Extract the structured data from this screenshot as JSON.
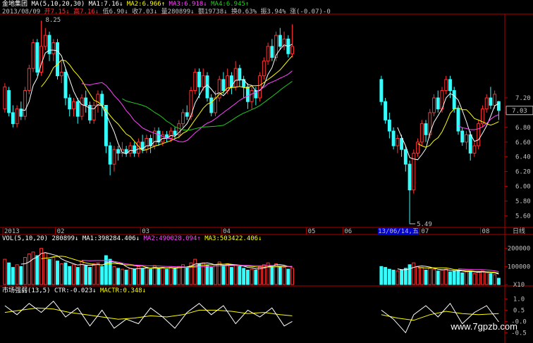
{
  "header": {
    "stock_name": "金地集团",
    "ma_label": "MA(5,10,20,30)",
    "ma1": "MA1:7.16↓",
    "ma2": "MA2:6.966↑",
    "ma3": "MA3:6.918↓",
    "ma4": "MA4:6.945↑",
    "date": "2013/08/09",
    "open": "开7.15↓",
    "high": "高7.16↓",
    "low": "低6.90↓",
    "close": "收7.03↓",
    "volume": "量280899↓",
    "amount": "额19738↓",
    "turnover": "换0.63%",
    "amplitude": "振3.94%",
    "change": "涨(-0.07)-0"
  },
  "price_panel": {
    "high_mark": "8.25",
    "low_mark": "5.49",
    "current_price": "7.03",
    "y_ticks": [
      "7.20",
      "7.00",
      "6.80",
      "6.60",
      "6.40",
      "6.20",
      "6.00",
      "5.80",
      "5.60"
    ],
    "x_ticks": [
      "2013",
      "02",
      "03",
      "04",
      "05",
      "06",
      "07",
      "08"
    ],
    "cursor_date": "13/06/14,五",
    "period": "日线"
  },
  "volume_panel": {
    "label": "VOL(5,10,20)",
    "value": "280899↓",
    "ma1": "MA1:398284.406↓",
    "ma2": "MA2:490028.094↑",
    "ma3": "MA3:503422.406↓",
    "y_ticks": [
      "200000",
      "100000",
      "X10"
    ]
  },
  "indicator_panel": {
    "name": "市场强弱(13,5)",
    "ctr": "CTR:-0.023↓",
    "mactr": "MACTR:0.348↓",
    "y_ticks": [
      "1.0",
      "0.5",
      "-0.0",
      "-0.5"
    ]
  },
  "watermark": "www.7gpzb.com",
  "colors": {
    "up": "#ff3333",
    "down": "#33ffff",
    "ma1": "#ffffff",
    "ma2": "#ffff00",
    "ma3": "#ff44ff",
    "ma4": "#22cc22",
    "axis": "#b00000"
  },
  "chart_data": {
    "type": "candlestick",
    "y_range": [
      5.45,
      8.3
    ],
    "gap_range": [
      85,
      92
    ],
    "candles": [
      [
        0,
        7.05,
        7.35,
        7.4,
        7.0
      ],
      [
        1,
        7.3,
        7.0,
        7.35,
        6.95
      ],
      [
        2,
        7.0,
        6.85,
        7.1,
        6.8
      ],
      [
        3,
        6.85,
        7.05,
        7.1,
        6.8
      ],
      [
        4,
        7.05,
        6.95,
        7.15,
        6.9
      ],
      [
        5,
        6.95,
        7.3,
        7.35,
        6.9
      ],
      [
        6,
        7.3,
        7.6,
        7.65,
        7.25
      ],
      [
        7,
        7.6,
        7.95,
        8.0,
        7.55
      ],
      [
        8,
        7.95,
        7.55,
        8.0,
        7.5
      ],
      [
        9,
        7.55,
        7.9,
        8.25,
        7.5
      ],
      [
        10,
        7.9,
        8.05,
        8.15,
        7.85
      ],
      [
        11,
        8.05,
        7.8,
        8.1,
        7.7
      ],
      [
        12,
        7.8,
        7.95,
        8.0,
        7.7
      ],
      [
        13,
        7.95,
        7.5,
        8.0,
        7.45
      ],
      [
        14,
        7.5,
        7.55,
        7.7,
        7.4
      ],
      [
        15,
        7.55,
        7.2,
        7.6,
        7.1
      ],
      [
        16,
        7.2,
        7.05,
        7.25,
        6.95
      ],
      [
        17,
        7.05,
        7.15,
        7.2,
        6.95
      ],
      [
        18,
        7.15,
        6.95,
        7.2,
        6.85
      ],
      [
        19,
        6.95,
        7.2,
        7.25,
        6.9
      ],
      [
        20,
        7.2,
        7.1,
        7.3,
        7.0
      ],
      [
        21,
        7.1,
        6.9,
        7.15,
        6.85
      ],
      [
        22,
        6.9,
        7.1,
        7.15,
        6.85
      ],
      [
        23,
        7.1,
        7.25,
        7.3,
        7.0
      ],
      [
        24,
        7.25,
        7.1,
        7.3,
        6.95
      ],
      [
        25,
        7.1,
        6.55,
        7.1,
        6.45
      ],
      [
        26,
        6.55,
        6.3,
        6.6,
        6.15
      ],
      [
        27,
        6.3,
        6.5,
        6.55,
        6.2
      ],
      [
        28,
        6.5,
        6.45,
        6.55,
        6.35
      ],
      [
        29,
        6.45,
        6.5,
        6.6,
        6.4
      ],
      [
        30,
        6.5,
        6.45,
        6.55,
        6.4
      ],
      [
        31,
        6.45,
        6.55,
        6.6,
        6.4
      ],
      [
        32,
        6.55,
        6.45,
        6.6,
        6.4
      ],
      [
        33,
        6.45,
        6.6,
        6.65,
        6.4
      ],
      [
        34,
        6.6,
        6.5,
        6.7,
        6.45
      ],
      [
        35,
        6.5,
        6.65,
        6.7,
        6.45
      ],
      [
        36,
        6.65,
        6.55,
        6.7,
        6.45
      ],
      [
        37,
        6.55,
        6.75,
        6.8,
        6.5
      ],
      [
        38,
        6.75,
        6.6,
        6.8,
        6.55
      ],
      [
        39,
        6.6,
        6.7,
        6.75,
        6.55
      ],
      [
        40,
        6.7,
        6.65,
        6.75,
        6.6
      ],
      [
        41,
        6.65,
        6.75,
        6.8,
        6.6
      ],
      [
        42,
        6.75,
        6.7,
        6.8,
        6.65
      ],
      [
        43,
        6.7,
        6.85,
        6.9,
        6.65
      ],
      [
        44,
        6.85,
        7.0,
        7.05,
        6.8
      ],
      [
        45,
        7.0,
        6.95,
        7.1,
        6.9
      ],
      [
        46,
        6.95,
        7.3,
        7.35,
        6.9
      ],
      [
        47,
        7.3,
        7.55,
        7.6,
        7.25
      ],
      [
        48,
        7.55,
        7.35,
        7.6,
        7.2
      ],
      [
        49,
        7.35,
        7.5,
        7.6,
        7.3
      ],
      [
        50,
        7.5,
        7.2,
        7.55,
        7.15
      ],
      [
        51,
        7.2,
        7.0,
        7.25,
        6.95
      ],
      [
        52,
        7.0,
        7.2,
        7.3,
        6.95
      ],
      [
        53,
        7.2,
        7.45,
        7.5,
        7.15
      ],
      [
        54,
        7.45,
        7.3,
        7.55,
        7.25
      ],
      [
        55,
        7.3,
        7.5,
        7.6,
        7.25
      ],
      [
        56,
        7.5,
        7.35,
        7.55,
        7.25
      ],
      [
        57,
        7.35,
        7.6,
        7.7,
        7.3
      ],
      [
        58,
        7.6,
        7.45,
        7.65,
        7.35
      ],
      [
        59,
        7.45,
        7.35,
        7.5,
        7.2
      ],
      [
        60,
        7.35,
        7.15,
        7.4,
        7.05
      ],
      [
        61,
        7.15,
        7.3,
        7.35,
        7.05
      ],
      [
        62,
        7.3,
        7.2,
        7.35,
        7.1
      ],
      [
        63,
        7.2,
        7.5,
        7.55,
        7.15
      ],
      [
        64,
        7.5,
        7.7,
        7.75,
        7.45
      ],
      [
        65,
        7.7,
        7.9,
        7.95,
        7.65
      ],
      [
        66,
        7.9,
        7.75,
        8.0,
        7.7
      ],
      [
        67,
        7.75,
        8.05,
        8.1,
        7.7
      ],
      [
        68,
        8.05,
        7.9,
        8.15,
        7.85
      ],
      [
        69,
        7.9,
        8.0,
        8.1,
        7.85
      ],
      [
        70,
        8.0,
        7.8,
        8.05,
        7.75
      ],
      [
        71,
        7.8,
        7.9,
        8.2,
        7.75
      ],
      [
        93,
        7.45,
        7.15,
        7.5,
        7.1
      ],
      [
        94,
        7.15,
        6.9,
        7.2,
        6.85
      ],
      [
        95,
        6.9,
        6.75,
        7.0,
        6.65
      ],
      [
        96,
        6.75,
        6.55,
        6.8,
        6.5
      ],
      [
        97,
        6.55,
        6.65,
        6.7,
        6.45
      ],
      [
        98,
        6.65,
        6.5,
        6.7,
        6.4
      ],
      [
        99,
        6.5,
        6.3,
        6.55,
        6.2
      ],
      [
        100,
        6.3,
        5.95,
        6.35,
        5.49
      ],
      [
        101,
        5.95,
        6.45,
        6.5,
        5.9
      ],
      [
        102,
        6.45,
        6.6,
        6.65,
        6.4
      ],
      [
        103,
        6.6,
        6.85,
        6.9,
        6.55
      ],
      [
        104,
        6.85,
        6.7,
        6.9,
        6.6
      ],
      [
        105,
        6.7,
        7.0,
        7.05,
        6.65
      ],
      [
        106,
        7.0,
        7.2,
        7.25,
        6.95
      ],
      [
        107,
        7.2,
        7.05,
        7.3,
        7.0
      ],
      [
        108,
        7.05,
        7.3,
        7.35,
        7.0
      ],
      [
        109,
        7.3,
        7.45,
        7.5,
        7.25
      ],
      [
        110,
        7.45,
        7.3,
        7.5,
        7.2
      ],
      [
        111,
        7.3,
        7.05,
        7.35,
        7.0
      ],
      [
        112,
        7.05,
        6.75,
        7.1,
        6.7
      ],
      [
        113,
        6.75,
        6.6,
        6.8,
        6.55
      ],
      [
        114,
        6.6,
        6.7,
        6.75,
        6.5
      ],
      [
        115,
        6.7,
        6.45,
        6.75,
        6.35
      ],
      [
        116,
        6.45,
        6.55,
        6.6,
        6.4
      ],
      [
        117,
        6.55,
        6.85,
        6.9,
        6.5
      ],
      [
        118,
        6.85,
        7.05,
        7.1,
        6.8
      ],
      [
        119,
        7.05,
        7.2,
        7.25,
        7.0
      ],
      [
        120,
        7.2,
        7.1,
        7.35,
        7.05
      ],
      [
        121,
        7.1,
        7.25,
        7.3,
        7.05
      ],
      [
        122,
        7.15,
        7.03,
        7.16,
        6.9
      ]
    ],
    "volumes": [
      [
        0,
        140000
      ],
      [
        1,
        120000
      ],
      [
        2,
        95000
      ],
      [
        3,
        110000
      ],
      [
        4,
        100000
      ],
      [
        5,
        150000
      ],
      [
        6,
        170000
      ],
      [
        7,
        180000
      ],
      [
        8,
        160000
      ],
      [
        9,
        200000
      ],
      [
        10,
        175000
      ],
      [
        11,
        140000
      ],
      [
        12,
        150000
      ],
      [
        13,
        130000
      ],
      [
        14,
        115000
      ],
      [
        15,
        120000
      ],
      [
        16,
        100000
      ],
      [
        17,
        110000
      ],
      [
        18,
        95000
      ],
      [
        19,
        130000
      ],
      [
        20,
        105000
      ],
      [
        21,
        95000
      ],
      [
        22,
        115000
      ],
      [
        23,
        120000
      ],
      [
        24,
        100000
      ],
      [
        25,
        160000
      ],
      [
        26,
        140000
      ],
      [
        27,
        100000
      ],
      [
        28,
        90000
      ],
      [
        29,
        85000
      ],
      [
        30,
        80000
      ],
      [
        31,
        90000
      ],
      [
        32,
        85000
      ],
      [
        33,
        100000
      ],
      [
        34,
        90000
      ],
      [
        35,
        95000
      ],
      [
        36,
        85000
      ],
      [
        37,
        105000
      ],
      [
        38,
        90000
      ],
      [
        39,
        95000
      ],
      [
        40,
        85000
      ],
      [
        41,
        95000
      ],
      [
        42,
        90000
      ],
      [
        43,
        100000
      ],
      [
        44,
        110000
      ],
      [
        45,
        95000
      ],
      [
        46,
        120000
      ],
      [
        47,
        140000
      ],
      [
        48,
        115000
      ],
      [
        49,
        120000
      ],
      [
        50,
        105000
      ],
      [
        51,
        95000
      ],
      [
        52,
        110000
      ],
      [
        53,
        125000
      ],
      [
        54,
        100000
      ],
      [
        55,
        115000
      ],
      [
        56,
        95000
      ],
      [
        57,
        110000
      ],
      [
        58,
        100000
      ],
      [
        59,
        90000
      ],
      [
        60,
        80000
      ],
      [
        61,
        85000
      ],
      [
        62,
        80000
      ],
      [
        63,
        100000
      ],
      [
        64,
        110000
      ],
      [
        65,
        120000
      ],
      [
        66,
        105000
      ],
      [
        67,
        115000
      ],
      [
        68,
        100000
      ],
      [
        69,
        95000
      ],
      [
        70,
        85000
      ],
      [
        71,
        90000
      ],
      [
        93,
        100000
      ],
      [
        94,
        95000
      ],
      [
        95,
        85000
      ],
      [
        96,
        80000
      ],
      [
        97,
        75000
      ],
      [
        98,
        80000
      ],
      [
        99,
        90000
      ],
      [
        100,
        110000
      ],
      [
        101,
        120000
      ],
      [
        102,
        100000
      ],
      [
        103,
        95000
      ],
      [
        104,
        80000
      ],
      [
        105,
        90000
      ],
      [
        106,
        85000
      ],
      [
        107,
        75000
      ],
      [
        108,
        80000
      ],
      [
        109,
        85000
      ],
      [
        110,
        70000
      ],
      [
        111,
        75000
      ],
      [
        112,
        80000
      ],
      [
        113,
        65000
      ],
      [
        114,
        70000
      ],
      [
        115,
        75000
      ],
      [
        116,
        60000
      ],
      [
        117,
        70000
      ],
      [
        118,
        75000
      ],
      [
        119,
        65000
      ],
      [
        120,
        60000
      ],
      [
        121,
        55000
      ],
      [
        122,
        35000
      ]
    ],
    "ctr": [
      [
        0,
        0.7
      ],
      [
        3,
        0.3
      ],
      [
        6,
        0.8
      ],
      [
        9,
        0.4
      ],
      [
        12,
        0.9
      ],
      [
        15,
        0.2
      ],
      [
        18,
        0.6
      ],
      [
        21,
        -0.2
      ],
      [
        24,
        0.5
      ],
      [
        27,
        -0.3
      ],
      [
        30,
        0.1
      ],
      [
        33,
        -0.1
      ],
      [
        36,
        0.6
      ],
      [
        39,
        0.2
      ],
      [
        42,
        -0.3
      ],
      [
        45,
        0.4
      ],
      [
        48,
        0.8
      ],
      [
        51,
        0.3
      ],
      [
        54,
        0.7
      ],
      [
        57,
        -0.1
      ],
      [
        60,
        0.5
      ],
      [
        63,
        0.2
      ],
      [
        66,
        0.6
      ],
      [
        69,
        -0.2
      ],
      [
        71,
        0.0
      ],
      [
        93,
        0.5
      ],
      [
        96,
        0.1
      ],
      [
        99,
        -0.5
      ],
      [
        101,
        0.3
      ],
      [
        104,
        0.7
      ],
      [
        107,
        0.2
      ],
      [
        110,
        0.8
      ],
      [
        113,
        -0.1
      ],
      [
        116,
        0.4
      ],
      [
        119,
        0.7
      ],
      [
        122,
        -0.02
      ]
    ],
    "mactr": [
      [
        0,
        0.4
      ],
      [
        4,
        0.5
      ],
      [
        8,
        0.6
      ],
      [
        12,
        0.55
      ],
      [
        16,
        0.4
      ],
      [
        20,
        0.3
      ],
      [
        24,
        0.2
      ],
      [
        28,
        0.1
      ],
      [
        32,
        0.15
      ],
      [
        36,
        0.25
      ],
      [
        40,
        0.2
      ],
      [
        44,
        0.3
      ],
      [
        48,
        0.5
      ],
      [
        52,
        0.5
      ],
      [
        56,
        0.45
      ],
      [
        60,
        0.35
      ],
      [
        64,
        0.4
      ],
      [
        68,
        0.3
      ],
      [
        71,
        0.25
      ],
      [
        93,
        0.3
      ],
      [
        97,
        0.15
      ],
      [
        101,
        0.05
      ],
      [
        105,
        0.3
      ],
      [
        109,
        0.45
      ],
      [
        113,
        0.35
      ],
      [
        117,
        0.3
      ],
      [
        122,
        0.35
      ]
    ]
  }
}
